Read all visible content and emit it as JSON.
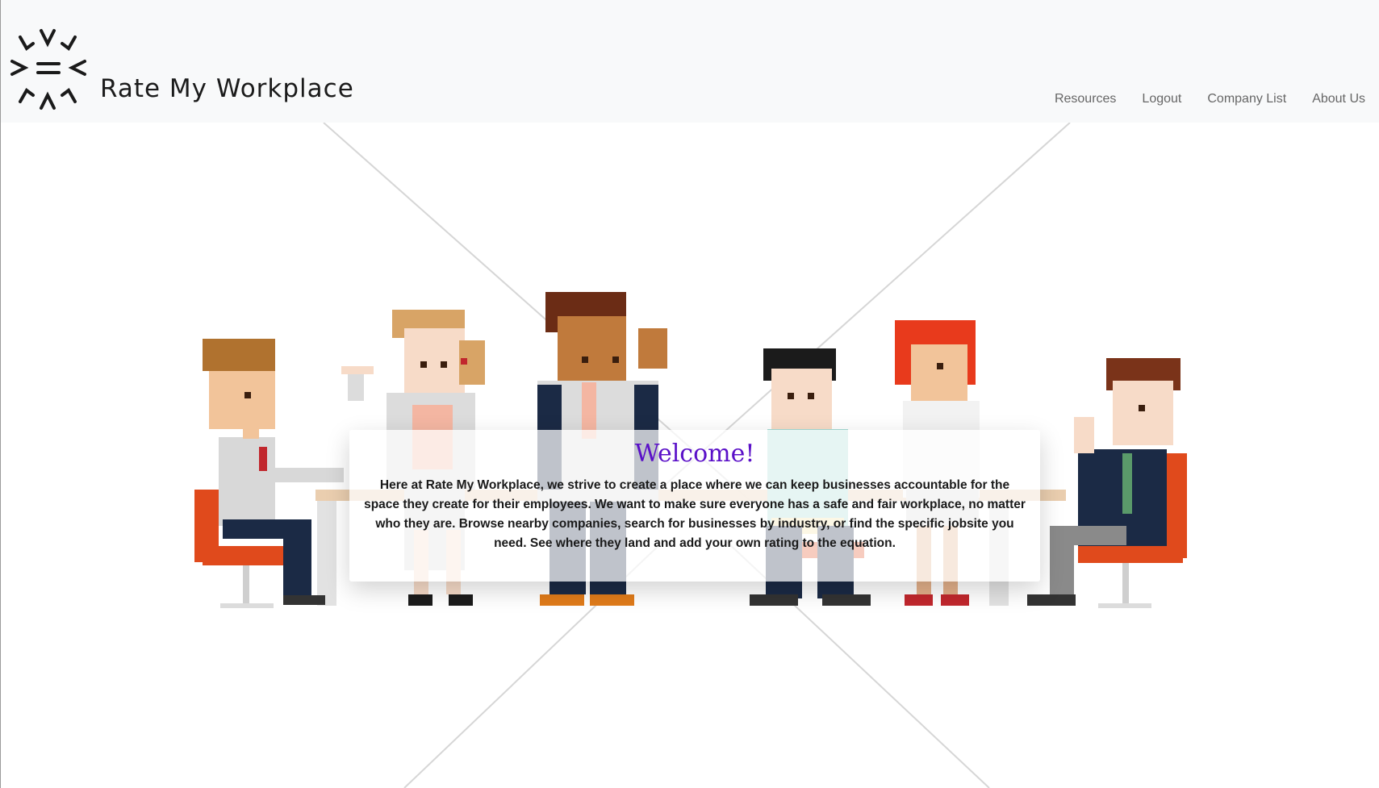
{
  "brand": {
    "name": "Rate My Workplace",
    "logo_icon": "sunburst-equals-icon"
  },
  "nav": {
    "items": [
      {
        "label": "Resources"
      },
      {
        "label": "Logout"
      },
      {
        "label": "Company List"
      },
      {
        "label": "About Us"
      }
    ]
  },
  "hero": {
    "illustration": "pixel-art-office-team",
    "welcome_title": "Welcome!",
    "welcome_text": "Here at Rate My Workplace, we strive to create a place where we can keep businesses accountable for the space they create for their employees. We want to make sure everyone has a safe and fair workplace, no matter who they are. Browse nearby companies, search for businesses by industry, or find the specific jobsite you need. See where they land and add your own rating to the equation."
  },
  "colors": {
    "accent": "#5a10c8",
    "chair": "#e0501f",
    "nav_text": "#666666"
  }
}
